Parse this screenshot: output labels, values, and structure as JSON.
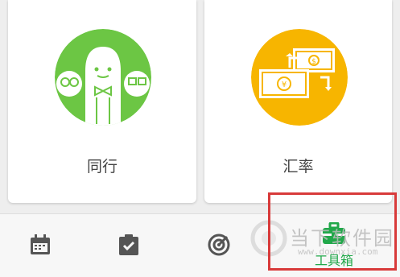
{
  "cards": [
    {
      "label": "同行",
      "icon": "companions-icon",
      "color": "#6cc644"
    },
    {
      "label": "汇率",
      "icon": "exchange-rate-icon",
      "color": "#f7b500"
    }
  ],
  "bottom_nav": [
    {
      "icon": "calendar-icon"
    },
    {
      "icon": "checklist-icon"
    },
    {
      "icon": "radar-icon"
    },
    {
      "icon": "toolbox-icon",
      "label": "工具箱",
      "active": true
    }
  ],
  "watermark": {
    "text": "当下软件园",
    "url": "www.downxia.com"
  },
  "colors": {
    "accent": "#21a84a",
    "highlight": "#d83a3a"
  }
}
